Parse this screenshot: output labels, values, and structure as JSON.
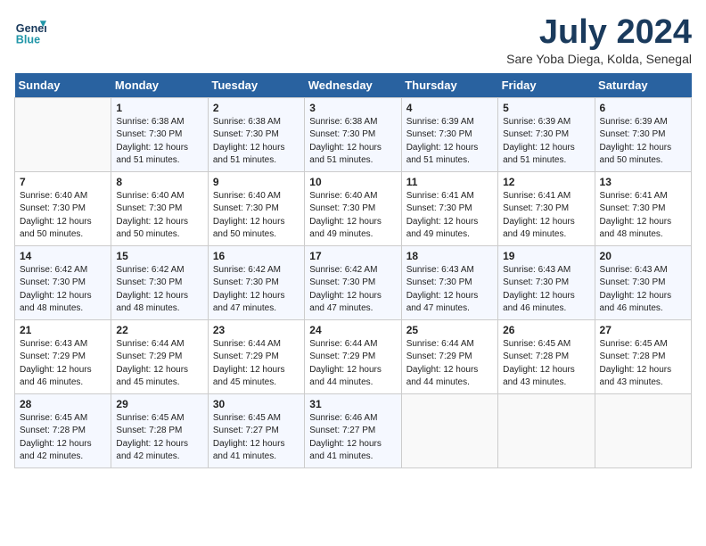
{
  "logo": {
    "line1": "General",
    "line2": "Blue"
  },
  "title": "July 2024",
  "location": "Sare Yoba Diega, Kolda, Senegal",
  "days_of_week": [
    "Sunday",
    "Monday",
    "Tuesday",
    "Wednesday",
    "Thursday",
    "Friday",
    "Saturday"
  ],
  "weeks": [
    [
      {
        "day": "",
        "sunrise": "",
        "sunset": "",
        "daylight": ""
      },
      {
        "day": "1",
        "sunrise": "Sunrise: 6:38 AM",
        "sunset": "Sunset: 7:30 PM",
        "daylight": "Daylight: 12 hours and 51 minutes."
      },
      {
        "day": "2",
        "sunrise": "Sunrise: 6:38 AM",
        "sunset": "Sunset: 7:30 PM",
        "daylight": "Daylight: 12 hours and 51 minutes."
      },
      {
        "day": "3",
        "sunrise": "Sunrise: 6:38 AM",
        "sunset": "Sunset: 7:30 PM",
        "daylight": "Daylight: 12 hours and 51 minutes."
      },
      {
        "day": "4",
        "sunrise": "Sunrise: 6:39 AM",
        "sunset": "Sunset: 7:30 PM",
        "daylight": "Daylight: 12 hours and 51 minutes."
      },
      {
        "day": "5",
        "sunrise": "Sunrise: 6:39 AM",
        "sunset": "Sunset: 7:30 PM",
        "daylight": "Daylight: 12 hours and 51 minutes."
      },
      {
        "day": "6",
        "sunrise": "Sunrise: 6:39 AM",
        "sunset": "Sunset: 7:30 PM",
        "daylight": "Daylight: 12 hours and 50 minutes."
      }
    ],
    [
      {
        "day": "7",
        "sunrise": "Sunrise: 6:40 AM",
        "sunset": "Sunset: 7:30 PM",
        "daylight": "Daylight: 12 hours and 50 minutes."
      },
      {
        "day": "8",
        "sunrise": "Sunrise: 6:40 AM",
        "sunset": "Sunset: 7:30 PM",
        "daylight": "Daylight: 12 hours and 50 minutes."
      },
      {
        "day": "9",
        "sunrise": "Sunrise: 6:40 AM",
        "sunset": "Sunset: 7:30 PM",
        "daylight": "Daylight: 12 hours and 50 minutes."
      },
      {
        "day": "10",
        "sunrise": "Sunrise: 6:40 AM",
        "sunset": "Sunset: 7:30 PM",
        "daylight": "Daylight: 12 hours and 49 minutes."
      },
      {
        "day": "11",
        "sunrise": "Sunrise: 6:41 AM",
        "sunset": "Sunset: 7:30 PM",
        "daylight": "Daylight: 12 hours and 49 minutes."
      },
      {
        "day": "12",
        "sunrise": "Sunrise: 6:41 AM",
        "sunset": "Sunset: 7:30 PM",
        "daylight": "Daylight: 12 hours and 49 minutes."
      },
      {
        "day": "13",
        "sunrise": "Sunrise: 6:41 AM",
        "sunset": "Sunset: 7:30 PM",
        "daylight": "Daylight: 12 hours and 48 minutes."
      }
    ],
    [
      {
        "day": "14",
        "sunrise": "Sunrise: 6:42 AM",
        "sunset": "Sunset: 7:30 PM",
        "daylight": "Daylight: 12 hours and 48 minutes."
      },
      {
        "day": "15",
        "sunrise": "Sunrise: 6:42 AM",
        "sunset": "Sunset: 7:30 PM",
        "daylight": "Daylight: 12 hours and 48 minutes."
      },
      {
        "day": "16",
        "sunrise": "Sunrise: 6:42 AM",
        "sunset": "Sunset: 7:30 PM",
        "daylight": "Daylight: 12 hours and 47 minutes."
      },
      {
        "day": "17",
        "sunrise": "Sunrise: 6:42 AM",
        "sunset": "Sunset: 7:30 PM",
        "daylight": "Daylight: 12 hours and 47 minutes."
      },
      {
        "day": "18",
        "sunrise": "Sunrise: 6:43 AM",
        "sunset": "Sunset: 7:30 PM",
        "daylight": "Daylight: 12 hours and 47 minutes."
      },
      {
        "day": "19",
        "sunrise": "Sunrise: 6:43 AM",
        "sunset": "Sunset: 7:30 PM",
        "daylight": "Daylight: 12 hours and 46 minutes."
      },
      {
        "day": "20",
        "sunrise": "Sunrise: 6:43 AM",
        "sunset": "Sunset: 7:30 PM",
        "daylight": "Daylight: 12 hours and 46 minutes."
      }
    ],
    [
      {
        "day": "21",
        "sunrise": "Sunrise: 6:43 AM",
        "sunset": "Sunset: 7:29 PM",
        "daylight": "Daylight: 12 hours and 46 minutes."
      },
      {
        "day": "22",
        "sunrise": "Sunrise: 6:44 AM",
        "sunset": "Sunset: 7:29 PM",
        "daylight": "Daylight: 12 hours and 45 minutes."
      },
      {
        "day": "23",
        "sunrise": "Sunrise: 6:44 AM",
        "sunset": "Sunset: 7:29 PM",
        "daylight": "Daylight: 12 hours and 45 minutes."
      },
      {
        "day": "24",
        "sunrise": "Sunrise: 6:44 AM",
        "sunset": "Sunset: 7:29 PM",
        "daylight": "Daylight: 12 hours and 44 minutes."
      },
      {
        "day": "25",
        "sunrise": "Sunrise: 6:44 AM",
        "sunset": "Sunset: 7:29 PM",
        "daylight": "Daylight: 12 hours and 44 minutes."
      },
      {
        "day": "26",
        "sunrise": "Sunrise: 6:45 AM",
        "sunset": "Sunset: 7:28 PM",
        "daylight": "Daylight: 12 hours and 43 minutes."
      },
      {
        "day": "27",
        "sunrise": "Sunrise: 6:45 AM",
        "sunset": "Sunset: 7:28 PM",
        "daylight": "Daylight: 12 hours and 43 minutes."
      }
    ],
    [
      {
        "day": "28",
        "sunrise": "Sunrise: 6:45 AM",
        "sunset": "Sunset: 7:28 PM",
        "daylight": "Daylight: 12 hours and 42 minutes."
      },
      {
        "day": "29",
        "sunrise": "Sunrise: 6:45 AM",
        "sunset": "Sunset: 7:28 PM",
        "daylight": "Daylight: 12 hours and 42 minutes."
      },
      {
        "day": "30",
        "sunrise": "Sunrise: 6:45 AM",
        "sunset": "Sunset: 7:27 PM",
        "daylight": "Daylight: 12 hours and 41 minutes."
      },
      {
        "day": "31",
        "sunrise": "Sunrise: 6:46 AM",
        "sunset": "Sunset: 7:27 PM",
        "daylight": "Daylight: 12 hours and 41 minutes."
      },
      {
        "day": "",
        "sunrise": "",
        "sunset": "",
        "daylight": ""
      },
      {
        "day": "",
        "sunrise": "",
        "sunset": "",
        "daylight": ""
      },
      {
        "day": "",
        "sunrise": "",
        "sunset": "",
        "daylight": ""
      }
    ]
  ]
}
